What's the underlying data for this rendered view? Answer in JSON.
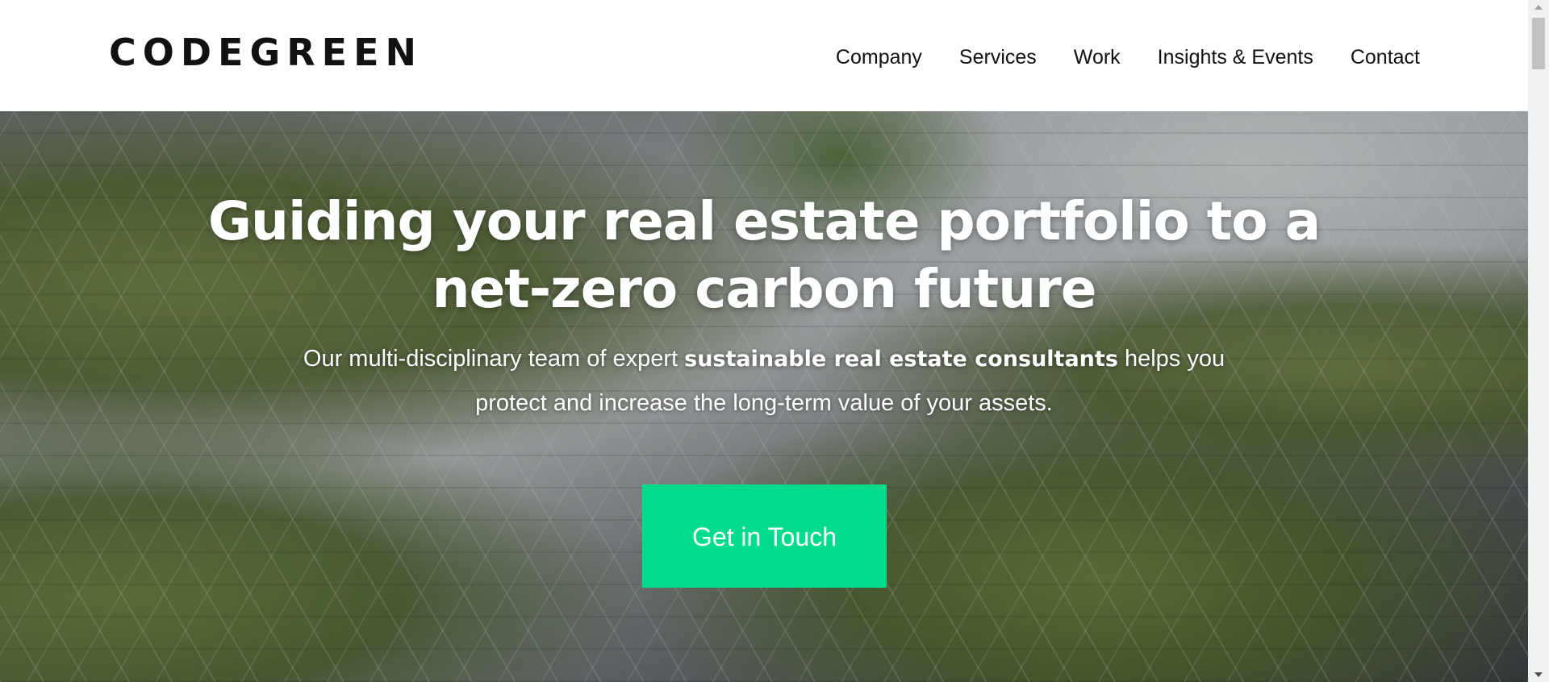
{
  "header": {
    "logo": "CODEGREEN",
    "nav": [
      "Company",
      "Services",
      "Work",
      "Insights & Events",
      "Contact"
    ]
  },
  "hero": {
    "title": "Guiding your real estate portfolio to a net-zero carbon future",
    "subtitle_pre": "Our multi-disciplinary team of expert ",
    "subtitle_bold": "sustainable real estate consultants",
    "subtitle_post": " helps you protect and increase the long-term value of your assets.",
    "cta_label": "Get in Touch",
    "background_image": "glass-building-with-trees"
  },
  "colors": {
    "accent": "#00dc8c",
    "text_dark": "#111111",
    "text_light": "#ffffff"
  }
}
